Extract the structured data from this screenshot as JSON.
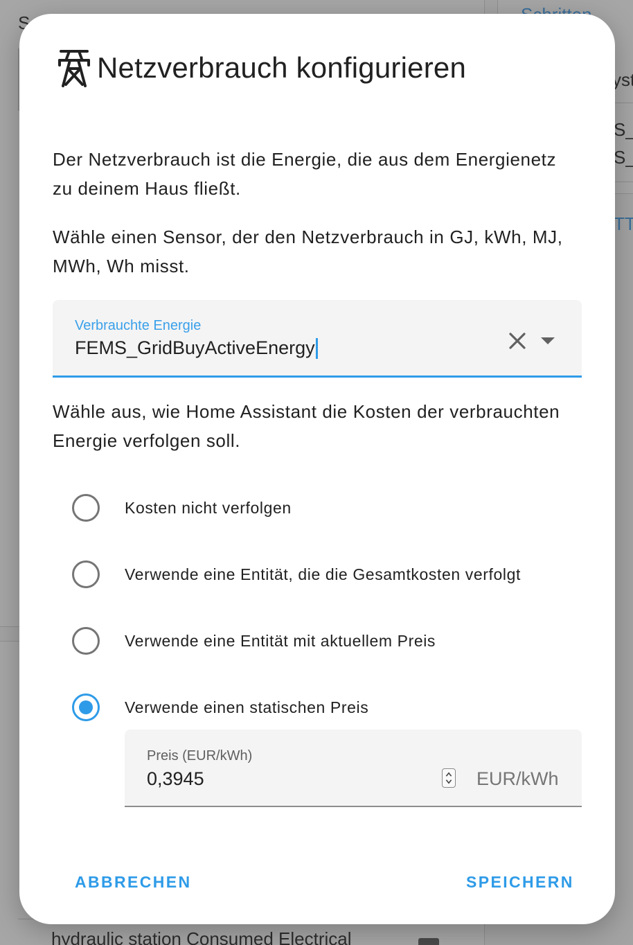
{
  "background": {
    "top_left_text": "Se",
    "top_right_text": "Schritten",
    "right_fragment_1": "yst",
    "right_fragment_2": "S_",
    "right_fragment_3": "S_",
    "right_fragment_4": "TT",
    "bottom_text": "hydraulic station Consumed Electrical"
  },
  "dialog": {
    "title": "Netzverbrauch konfigurieren",
    "title_icon": "transmission-tower-icon",
    "description": "Der Netzverbrauch ist die Energie, die aus dem Energienetz zu deinem Haus fließt.",
    "sensor_hint": "Wähle einen Sensor, der den Netzverbrauch in GJ, kWh, MJ, MWh, Wh misst.",
    "energy_field": {
      "label": "Verbrauchte Energie",
      "value": "FEMS_GridBuyActiveEnergy"
    },
    "cost_hint": "Wähle aus, wie Home Assistant die Kosten der verbrauchten Energie verfolgen soll.",
    "cost_options": [
      {
        "label": "Kosten nicht verfolgen",
        "checked": false
      },
      {
        "label": "Verwende eine Entität, die die Gesamtkosten verfolgt",
        "checked": false
      },
      {
        "label": "Verwende eine Entität mit aktuellem Preis",
        "checked": false
      },
      {
        "label": "Verwende einen statischen Preis",
        "checked": true
      }
    ],
    "price_field": {
      "label": "Preis (EUR/kWh)",
      "value": "0,3945",
      "suffix": "EUR/kWh"
    },
    "cancel_label": "ABBRECHEN",
    "save_label": "SPEICHERN"
  },
  "colors": {
    "accent": "#2e9be8",
    "overlay": "#a3a3a3"
  }
}
